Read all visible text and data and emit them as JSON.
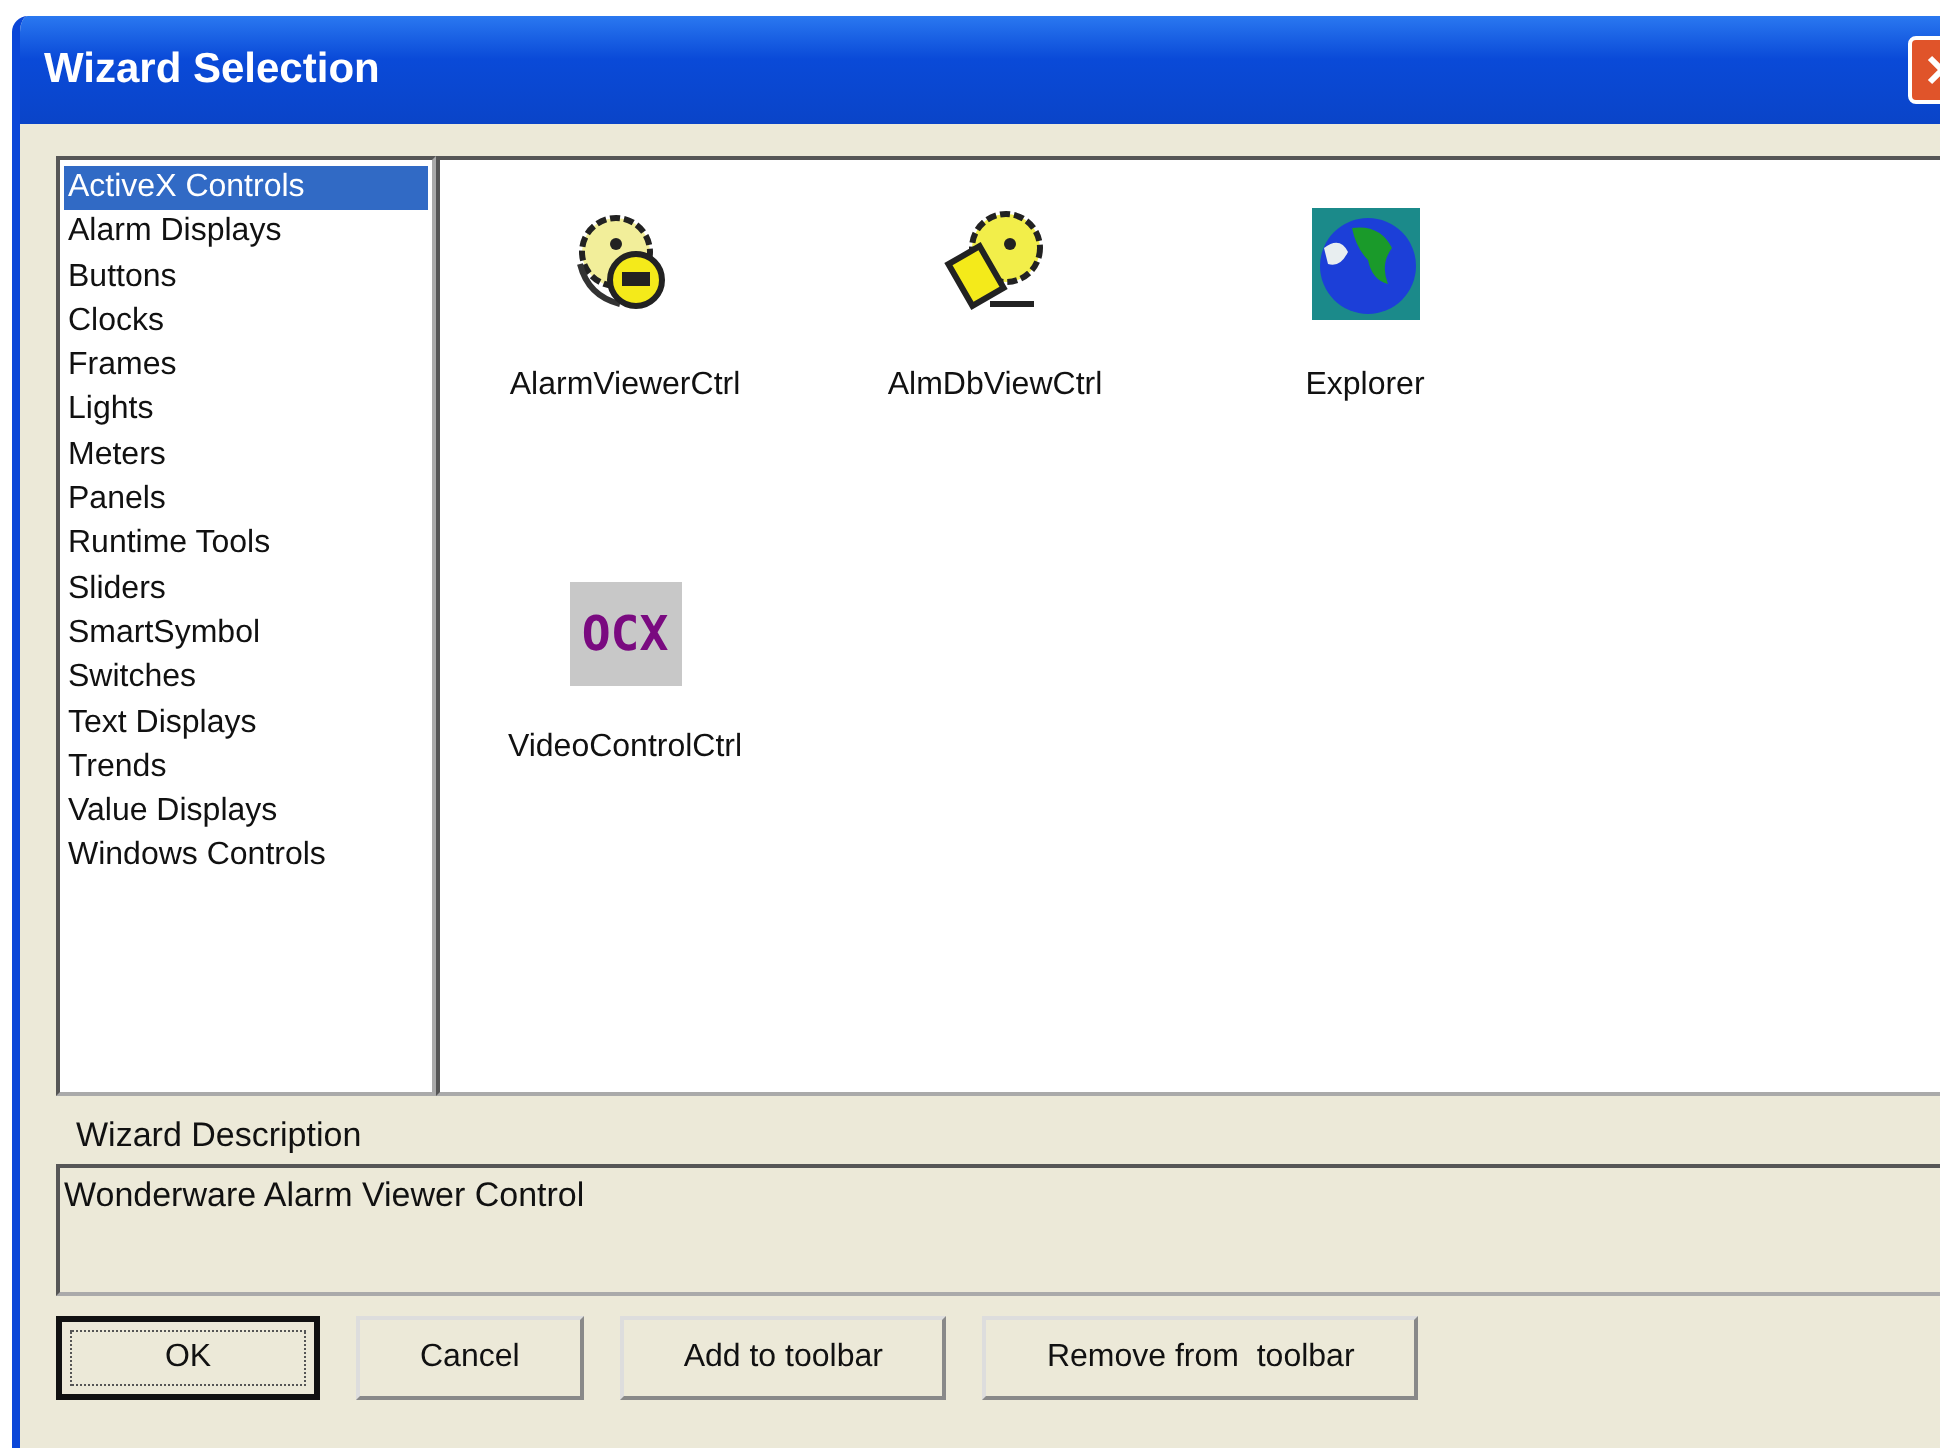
{
  "window": {
    "title": "Wizard Selection"
  },
  "categories": [
    {
      "label": "ActiveX Controls",
      "selected": true
    },
    {
      "label": "Alarm Displays",
      "selected": false
    },
    {
      "label": "Buttons",
      "selected": false
    },
    {
      "label": "Clocks",
      "selected": false
    },
    {
      "label": "Frames",
      "selected": false
    },
    {
      "label": "Lights",
      "selected": false
    },
    {
      "label": "Meters",
      "selected": false
    },
    {
      "label": "Panels",
      "selected": false
    },
    {
      "label": "Runtime Tools",
      "selected": false
    },
    {
      "label": "Sliders",
      "selected": false
    },
    {
      "label": "SmartSymbol",
      "selected": false
    },
    {
      "label": "Switches",
      "selected": false
    },
    {
      "label": "Text Displays",
      "selected": false
    },
    {
      "label": "Trends",
      "selected": false
    },
    {
      "label": "Value Displays",
      "selected": false
    },
    {
      "label": "Windows Controls",
      "selected": false
    }
  ],
  "wizards": [
    {
      "label": "AlarmViewerCtrl",
      "kind": "alarm"
    },
    {
      "label": "AlmDbViewCtrl",
      "kind": "database"
    },
    {
      "label": "Explorer",
      "kind": "globe"
    },
    {
      "label": "VideoControlCtrl",
      "kind": "ocx",
      "icon_text": "OCX"
    }
  ],
  "description": {
    "label": "Wizard Description",
    "text": "Wonderware Alarm Viewer Control"
  },
  "buttons": [
    {
      "label": "OK",
      "default": true
    },
    {
      "label": "Cancel",
      "default": false
    },
    {
      "label": "Add to toolbar",
      "default": false
    },
    {
      "label": "Remove from  toolbar",
      "default": false
    }
  ]
}
